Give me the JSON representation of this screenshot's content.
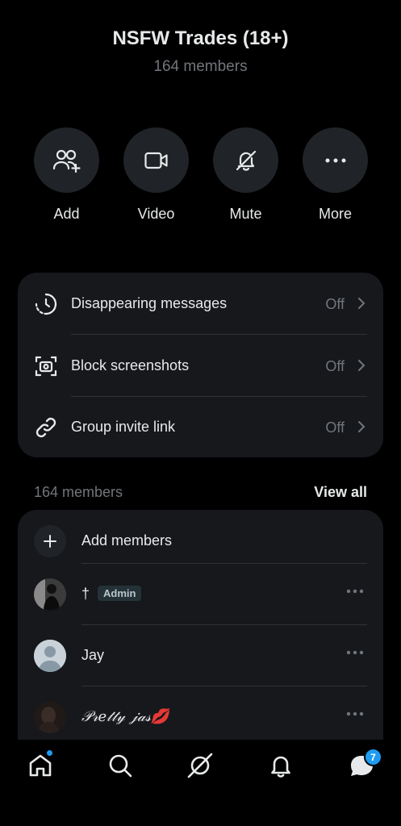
{
  "group": {
    "name": "NSFW Trades (18+)",
    "member_count_label": "164 members"
  },
  "actions": [
    {
      "label": "Add",
      "icon": "add-people-icon"
    },
    {
      "label": "Video",
      "icon": "video-camera-icon"
    },
    {
      "label": "Mute",
      "icon": "bell-off-icon"
    },
    {
      "label": "More",
      "icon": "more-horizontal-icon"
    }
  ],
  "settings": [
    {
      "label": "Disappearing messages",
      "value": "Off",
      "icon": "timer-icon"
    },
    {
      "label": "Block screenshots",
      "value": "Off",
      "icon": "screenshot-block-icon"
    },
    {
      "label": "Group invite link",
      "value": "Off",
      "icon": "link-icon"
    }
  ],
  "members_section": {
    "count_label": "164 members",
    "view_all_label": "View all",
    "add_members_label": "Add members",
    "list": [
      {
        "name": "†",
        "badge": "Admin"
      },
      {
        "name": "Jay"
      },
      {
        "name": "𝒫𝓇𝑒𝓉𝓉𝓎 𝒿𝒶𝓈💋"
      }
    ]
  },
  "tabbar": {
    "items": [
      "home",
      "search",
      "grok",
      "notifications",
      "messages"
    ],
    "messages_badge": "7"
  },
  "colors": {
    "background": "#000000",
    "card": "#16181c",
    "button_circle": "#202327",
    "secondary_text": "#71767b",
    "accent": "#1d9bf0"
  }
}
